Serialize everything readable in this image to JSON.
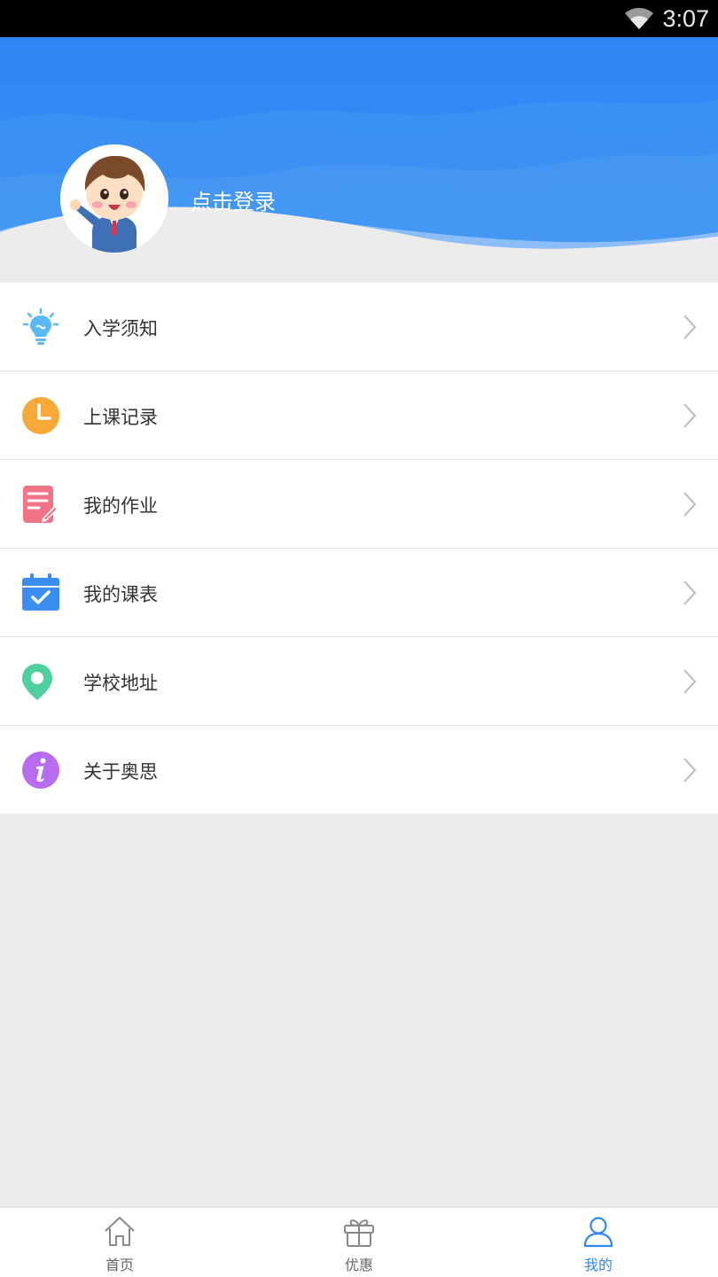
{
  "status_bar": {
    "time": "3:07"
  },
  "profile": {
    "login_text": "点击登录"
  },
  "menu": {
    "items": [
      {
        "label": "入学须知",
        "icon": "lightbulb-icon",
        "color": "#5ab8f2"
      },
      {
        "label": "上课记录",
        "icon": "clock-icon",
        "color": "#f6a838"
      },
      {
        "label": "我的作业",
        "icon": "homework-icon",
        "color": "#f07386"
      },
      {
        "label": "我的课表",
        "icon": "calendar-icon",
        "color": "#3b8ef0"
      },
      {
        "label": "学校地址",
        "icon": "location-pin-icon",
        "color": "#4fcf9e"
      },
      {
        "label": "关于奥思",
        "icon": "info-icon",
        "color": "#b76cf0"
      }
    ]
  },
  "tabbar": {
    "tabs": [
      {
        "label": "首页",
        "icon": "home-icon",
        "active": false
      },
      {
        "label": "优惠",
        "icon": "gift-icon",
        "active": false
      },
      {
        "label": "我的",
        "icon": "user-icon",
        "active": true
      }
    ]
  },
  "colors": {
    "accent": "#2f86f0",
    "header_blue": "#2b86f2"
  }
}
